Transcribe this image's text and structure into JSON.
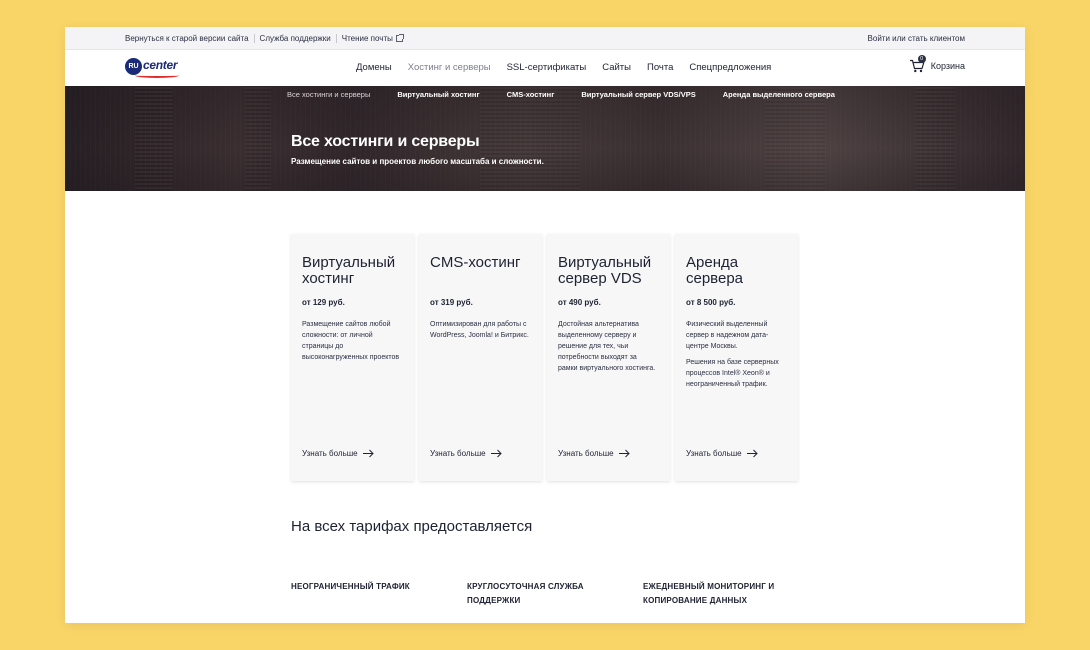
{
  "utilbar": {
    "links": [
      "Вернуться к старой версии сайта",
      "Служба поддержки",
      "Чтение почты"
    ],
    "login": "Войти или стать клиентом"
  },
  "header": {
    "logo_ru": "RU",
    "logo_center": "center",
    "nav": [
      "Домены",
      "Хостинг и серверы",
      "SSL-сертификаты",
      "Сайты",
      "Почта",
      "Спецпредложения"
    ],
    "nav_active": "Хостинг и серверы",
    "cart_label": "Корзина",
    "cart_count": "0"
  },
  "hero": {
    "subnav": [
      "Все хостинги и серверы",
      "Виртуальный хостинг",
      "CMS-хостинг",
      "Виртуальный сервер VDS/VPS",
      "Аренда выделенного сервера"
    ],
    "title": "Все хостинги и серверы",
    "subtitle": "Размещение сайтов и проектов любого масштаба и сложности."
  },
  "cards": [
    {
      "title": "Виртуальный хостинг",
      "price": "от 129 руб.",
      "desc": [
        "Размещение сайтов любой сложности: от личной страницы до высоконагруженных проектов"
      ],
      "more": "Узнать больше"
    },
    {
      "title": "CMS-хостинг",
      "price": "от 319 руб.",
      "desc": [
        "Оптимизирован для работы с WordPress, Joomla! и Битрикс."
      ],
      "more": "Узнать больше"
    },
    {
      "title": "Виртуальный сервер VDS",
      "price": "от 490 руб.",
      "desc": [
        "Достойная альтернатива выделенному серверу и решение для тех, чьи потребности выходят за рамки виртуального хостинга."
      ],
      "more": "Узнать больше"
    },
    {
      "title": "Аренда сервера",
      "price": "от 8 500 руб.",
      "desc": [
        "Физический выделенный сервер в надежном дата-центре Москвы.",
        "Решения на базе серверных процессов Intel® Xeon® и неограниченный трафик."
      ],
      "more": "Узнать больше"
    }
  ],
  "features": {
    "title": "На всех тарифах предоставляется",
    "items": [
      "НЕОГРАНИЧЕННЫЙ ТРАФИК",
      "КРУГЛОСУТОЧНАЯ СЛУЖБА ПОДДЕРЖКИ",
      "ЕЖЕДНЕВНЫЙ МОНИТОРИНГ И КОПИРОВАНИЕ ДАННЫХ"
    ]
  },
  "colors": {
    "background": "#f9d568",
    "brand": "#1b2a78",
    "accent": "#e22b2b",
    "text": "#1e2233"
  }
}
